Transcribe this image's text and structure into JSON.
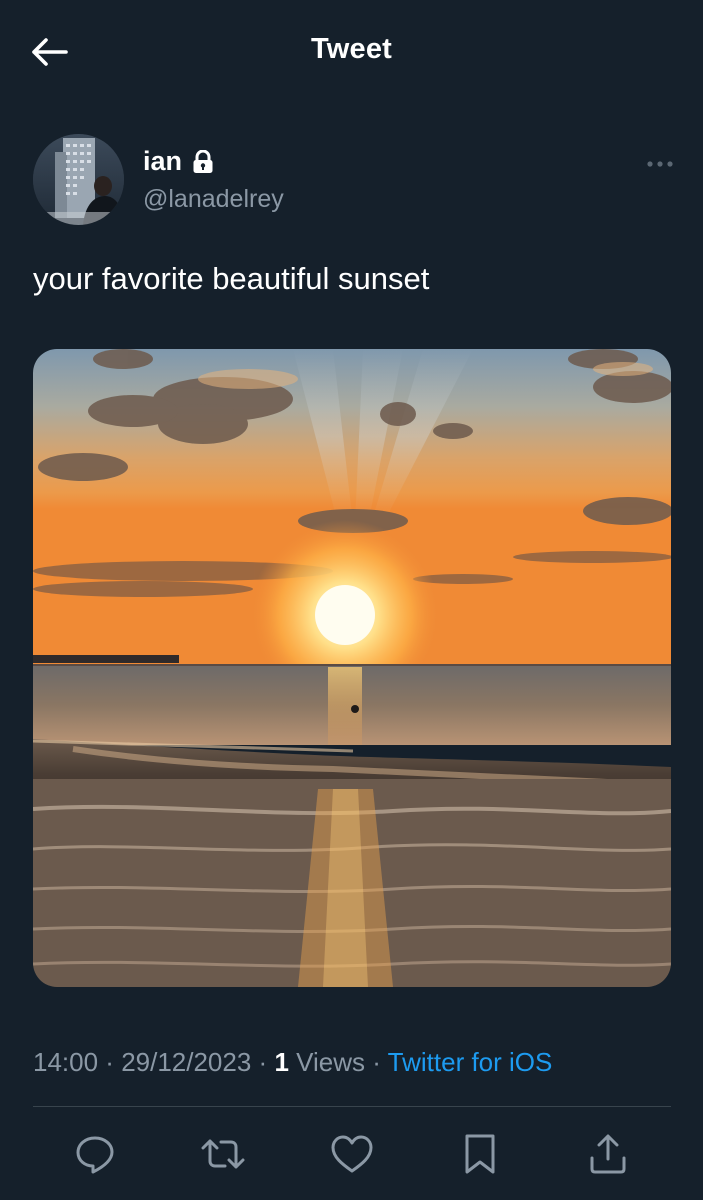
{
  "header": {
    "title": "Tweet",
    "back_icon": "arrow-left-icon"
  },
  "author": {
    "display_name": "ian",
    "handle": "@lanadelrey",
    "protected_icon": "lock-icon",
    "more_icon": "more-horizontal-icon"
  },
  "tweet": {
    "text": "your favorite beautiful sunset"
  },
  "meta": {
    "time": "14:00",
    "separator": " · ",
    "date": "29/12/2023",
    "views_count": "1",
    "views_label": " Views",
    "source": "Twitter for iOS"
  },
  "actions": [
    {
      "icon": "reply-icon"
    },
    {
      "icon": "retweet-icon"
    },
    {
      "icon": "like-icon"
    },
    {
      "icon": "bookmark-icon"
    },
    {
      "icon": "share-icon"
    }
  ],
  "colors": {
    "background": "#15202b",
    "secondary_text": "#8b98a5",
    "link": "#1d9bf0",
    "divider": "#38444d",
    "icon": "#8b98a5"
  }
}
